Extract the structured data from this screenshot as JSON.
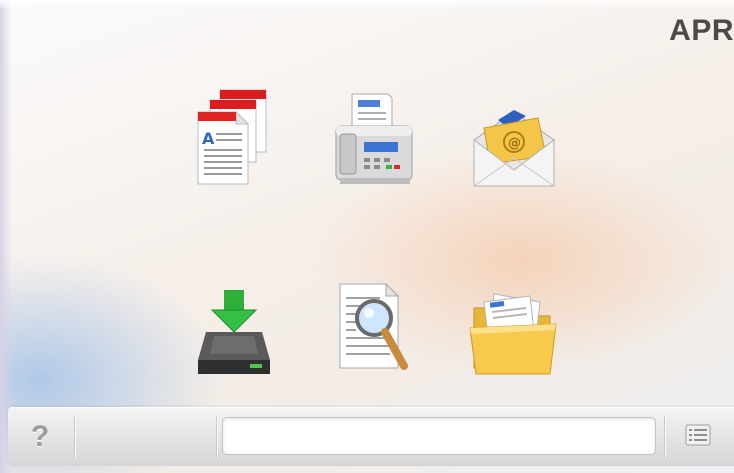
{
  "brand": {
    "text": "APR"
  },
  "tiles": [
    {
      "name": "copy",
      "icon": "copy-documents-icon"
    },
    {
      "name": "fax",
      "icon": "fax-machine-icon"
    },
    {
      "name": "email",
      "icon": "email-envelope-icon"
    },
    {
      "name": "scan-to-device",
      "icon": "scan-download-icon"
    },
    {
      "name": "scan-to-network",
      "icon": "document-magnifier-icon"
    },
    {
      "name": "held-jobs",
      "icon": "folder-documents-icon"
    }
  ],
  "bottom_bar": {
    "help_label": "?",
    "status_text": "",
    "menu_icon": "list-menu-icon"
  },
  "colors": {
    "brand_text": "#4a4a4a",
    "help_glyph": "#9b9b9b",
    "bar_light": "#f4f4f4",
    "bar_dark": "#d6d6d6"
  }
}
